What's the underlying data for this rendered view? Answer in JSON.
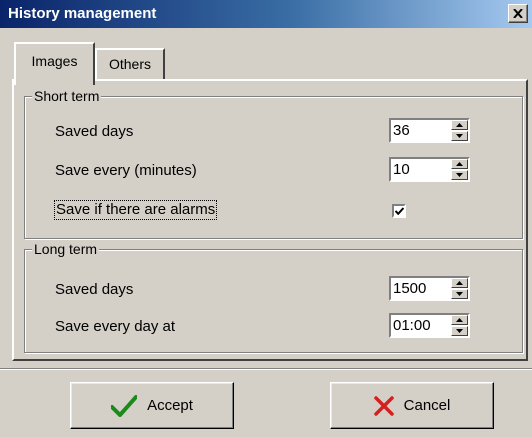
{
  "window": {
    "title": "History management"
  },
  "tabs": [
    {
      "label": "Images",
      "selected": true
    },
    {
      "label": "Others",
      "selected": false
    }
  ],
  "short_term": {
    "title": "Short term",
    "saved_days_label": "Saved days",
    "saved_days_value": "36",
    "save_every_label": "Save every (minutes)",
    "save_every_value": "10",
    "alarms_label": "Save if there are alarms",
    "alarms_checked": true
  },
  "long_term": {
    "title": "Long term",
    "saved_days_label": "Saved days",
    "saved_days_value": "1500",
    "save_every_day_label": "Save every day at",
    "save_every_day_value": "01:00"
  },
  "buttons": {
    "accept_label": "Accept",
    "cancel_label": "Cancel"
  },
  "icons": {
    "close": "close-icon",
    "accept": "checkmark-icon",
    "cancel": "cross-icon",
    "spin_up": "arrow-up-icon",
    "spin_down": "arrow-down-icon"
  },
  "colors": {
    "title_start": "#0a246a",
    "title_end": "#a6caf0",
    "accept_icon": "#1a8a1a",
    "cancel_icon": "#d42020"
  }
}
